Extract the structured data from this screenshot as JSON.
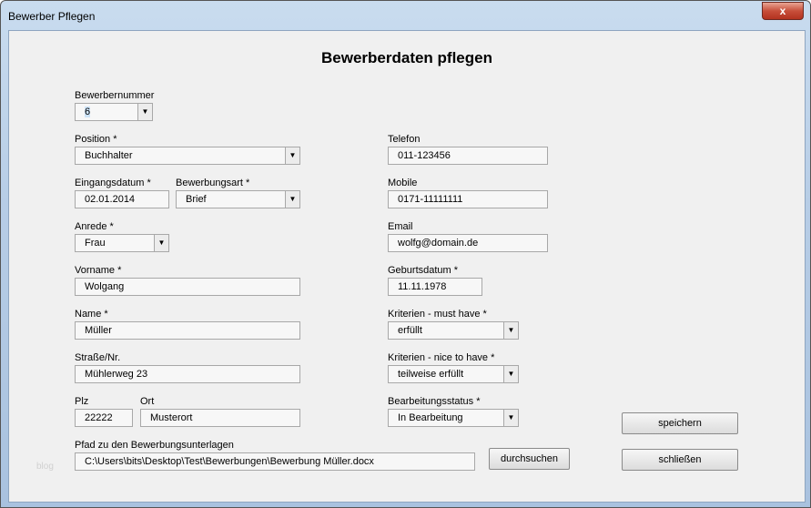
{
  "window": {
    "title": "Bewerber Pflegen",
    "close": "x"
  },
  "heading": "Bewerberdaten pflegen",
  "watermark": "blog",
  "fields": {
    "bewerbernummer": {
      "label": "Bewerbernummer",
      "value": "6"
    },
    "position": {
      "label": "Position *",
      "value": "Buchhalter"
    },
    "eingangsdatum": {
      "label": "Eingangsdatum *",
      "value": "02.01.2014"
    },
    "bewerbungsart": {
      "label": "Bewerbungsart *",
      "value": "Brief"
    },
    "anrede": {
      "label": "Anrede *",
      "value": "Frau"
    },
    "vorname": {
      "label": "Vorname *",
      "value": "Wolgang"
    },
    "name": {
      "label": "Name *",
      "value": "Müller"
    },
    "strasse": {
      "label": "Straße/Nr.",
      "value": "Mühlerweg 23"
    },
    "plz": {
      "label": "Plz",
      "value": "22222"
    },
    "ort": {
      "label": "Ort",
      "value": "Musterort"
    },
    "pfad": {
      "label": "Pfad zu den Bewerbungsunterlagen",
      "value": "C:\\Users\\bits\\Desktop\\Test\\Bewerbungen\\Bewerbung Müller.docx"
    },
    "telefon": {
      "label": "Telefon",
      "value": "011-123456"
    },
    "mobile": {
      "label": "Mobile",
      "value": "0171-11111111"
    },
    "email": {
      "label": "Email",
      "value": "wolfg@domain.de"
    },
    "geburtsdatum": {
      "label": "Geburtsdatum *",
      "value": "11.11.1978"
    },
    "must": {
      "label": "Kriterien - must have *",
      "value": "erfüllt"
    },
    "nice": {
      "label": "Kriterien - nice to have *",
      "value": "teilweise erfüllt"
    },
    "status": {
      "label": "Bearbeitungsstatus *",
      "value": "In Bearbeitung"
    }
  },
  "buttons": {
    "browse": "durchsuchen",
    "save": "speichern",
    "close": "schließen"
  }
}
